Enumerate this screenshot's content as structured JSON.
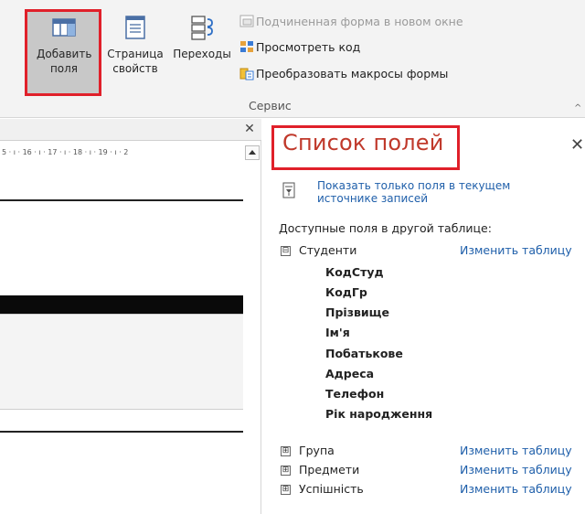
{
  "ribbon": {
    "add_fields_label": "Добавить поля",
    "property_page_label": "Страница свойств",
    "transitions_label": "Переходы",
    "subform_new_window_label": "Подчиненная форма в новом окне",
    "view_code_label": "Просмотреть код",
    "convert_macros_label": "Преобразовать макросы формы",
    "group_label": "Сервис"
  },
  "designer": {
    "ruler_text": "5 · ı · 16 · ı · 17 · ı · 18 · ı · 19 · ı · 2"
  },
  "field_list": {
    "title": "Список полей",
    "show_only_label": "Показать только поля в текущем источнике записей",
    "available_label": "Доступные поля в другой таблице:",
    "change_table_label": "Изменить таблицу",
    "tables": [
      {
        "name": "Студенти",
        "expanded": true,
        "expander": "⊟"
      },
      {
        "name": "Група",
        "expanded": false,
        "expander": "⊞"
      },
      {
        "name": "Предмети",
        "expanded": false,
        "expander": "⊞"
      },
      {
        "name": "Успішність",
        "expanded": false,
        "expander": "⊞"
      }
    ],
    "fields": [
      "КодСтуд",
      "КодГр",
      "Прізвище",
      "Ім'я",
      "Побатькове",
      "Адреса",
      "Телефон",
      "Рік народження"
    ]
  },
  "colors": {
    "highlight_frame": "#e0202a",
    "title": "#c0392b",
    "link": "#1f5faa"
  }
}
